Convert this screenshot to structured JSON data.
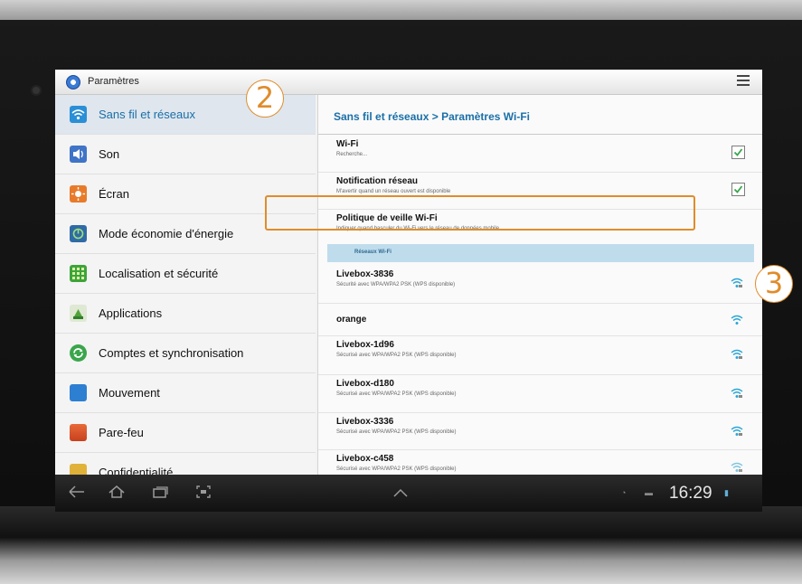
{
  "app": {
    "title": "Paramètres"
  },
  "sidebar": {
    "items": [
      {
        "label": "Sans fil et réseaux",
        "icon": "wifi-icon",
        "color": "#2a8fd6"
      },
      {
        "label": "Son",
        "icon": "speaker-icon",
        "color": "#3f74c7"
      },
      {
        "label": "Écran",
        "icon": "brightness-icon",
        "color": "#e87b2a"
      },
      {
        "label": "Mode économie d'énergie",
        "icon": "battery-saver-icon",
        "color": "#2f6ba6"
      },
      {
        "label": "Localisation et sécurité",
        "icon": "grid-icon",
        "color": "#3ea33a"
      },
      {
        "label": "Applications",
        "icon": "android-icon",
        "color": "#7cb342"
      },
      {
        "label": "Comptes et synchronisation",
        "icon": "sync-icon",
        "color": "#3aa54b"
      },
      {
        "label": "Mouvement",
        "icon": "motion-icon",
        "color": "#2d7fd1"
      },
      {
        "label": "Pare-feu",
        "icon": "firewall-icon",
        "color": "#d84a2a"
      },
      {
        "label": "Confidentialité",
        "icon": "privacy-icon",
        "color": "#e0b23a"
      }
    ]
  },
  "content": {
    "breadcrumb": "Sans fil et réseaux > Paramètres Wi-Fi",
    "settings": [
      {
        "title": "Wi-Fi",
        "subtitle": "Recherche...",
        "checked": true
      },
      {
        "title": "Notification réseau",
        "subtitle": "M'avertir quand un réseau ouvert est disponible",
        "checked": true
      },
      {
        "title": "Politique de veille Wi-Fi",
        "subtitle": "Indiquer quand basculer du Wi-Fi vers le réseau de données mobile",
        "checked": false
      }
    ],
    "section_header": "Réseaux Wi-Fi",
    "networks": [
      {
        "name": "Livebox-3836",
        "security": "Sécurité avec WPA/WPA2 PSK (WPS disponible)",
        "secured": true
      },
      {
        "name": "orange",
        "security": "",
        "secured": false
      },
      {
        "name": "Livebox-1d96",
        "security": "Sécurisé avec WPA/WPA2 PSK (WPS disponible)",
        "secured": true
      },
      {
        "name": "Livebox-d180",
        "security": "Sécurisé avec WPA/WPA2 PSK (WPS disponible)",
        "secured": true
      },
      {
        "name": "Livebox-3336",
        "security": "Sécurisé avec WPA/WPA2 PSK (WPS disponible)",
        "secured": true
      },
      {
        "name": "Livebox-c458",
        "security": "Sécurisé avec WPA/WPA2 PSK (WPS disponible)",
        "secured": true
      }
    ]
  },
  "callouts": {
    "step2": "2",
    "step3": "3"
  },
  "statusbar": {
    "time": "16:29"
  },
  "colors": {
    "accent": "#1a6fa8",
    "highlight": "#e08c2a",
    "wifi": "#2aa5d6",
    "section": "#bfdcec"
  }
}
